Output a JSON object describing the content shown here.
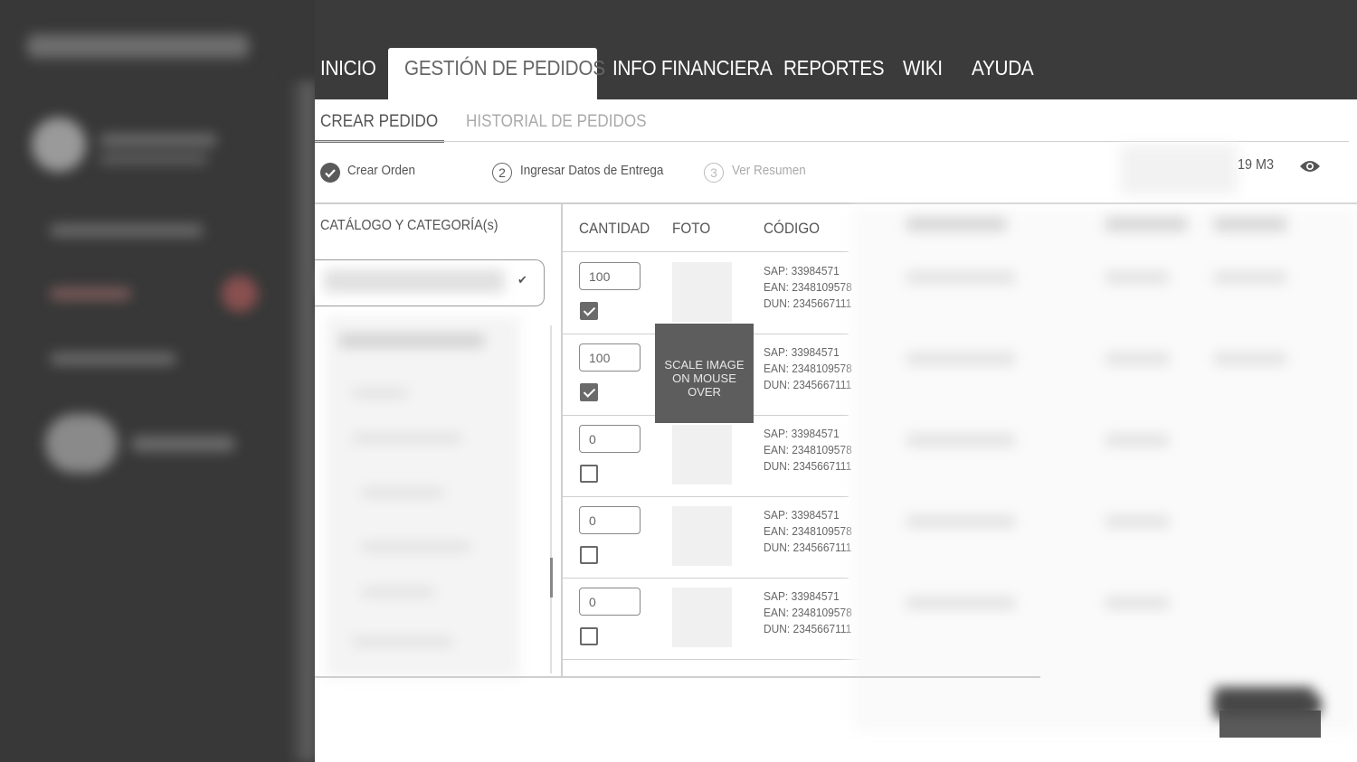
{
  "nav": {
    "items": [
      "INICIO",
      "GESTIÓN DE PEDIDOS",
      "INFO FINANCIERA",
      "REPORTES",
      "WIKI",
      "AYUDA"
    ],
    "active_index": 1
  },
  "subtabs": [
    "CREAR PEDIDO",
    "HISTORIAL DE PEDIDOS"
  ],
  "steps": [
    {
      "number": "",
      "label": "Crear Orden",
      "state": "done"
    },
    {
      "number": "2",
      "label": "Ingresar Datos de Entrega",
      "state": "current"
    },
    {
      "number": "3",
      "label": "Ver Resumen",
      "state": "pending"
    }
  ],
  "volume": "19 M3",
  "catalog": {
    "label": "CATÁLOGO  Y CATEGORÍA(s)"
  },
  "table": {
    "headers": [
      "CANTIDAD",
      "FOTO",
      "CÓDIGO"
    ],
    "rows": [
      {
        "qty": "100",
        "checked": true,
        "sap": "SAP: 33984571",
        "ean": "EAN: 2348109578",
        "dun": "DUN: 2345667111"
      },
      {
        "qty": "100",
        "checked": true,
        "sap": "SAP: 33984571",
        "ean": "EAN: 2348109578",
        "dun": "DUN: 2345667111"
      },
      {
        "qty": "0",
        "checked": false,
        "sap": "SAP: 33984571",
        "ean": "EAN: 2348109578",
        "dun": "DUN: 2345667111"
      },
      {
        "qty": "0",
        "checked": false,
        "sap": "SAP: 33984571",
        "ean": "EAN: 2348109578",
        "dun": "DUN: 2345667111"
      },
      {
        "qty": "0",
        "checked": false,
        "sap": "SAP: 33984571",
        "ean": "EAN: 2348109578",
        "dun": "DUN: 2345667111"
      }
    ]
  },
  "image_overlay": {
    "line1": "SCALE IMAGE",
    "line2": "ON MOUSE OVER"
  },
  "colors": {
    "dark_bg": "#3b3b3b",
    "panel_bg": "#ffffff",
    "accent_gray": "#6a6a6a"
  }
}
